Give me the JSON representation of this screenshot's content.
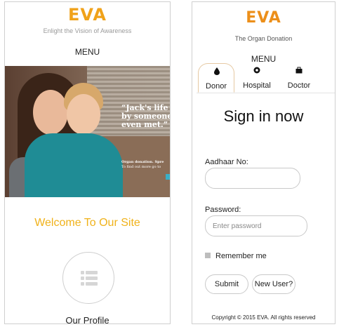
{
  "left_screen": {
    "brand": "EVA",
    "tagline": "Enlight the Vision of Awareness",
    "menu_label": "MENU",
    "hero": {
      "quote_lines": [
        "“Jack's life w",
        "by someone",
        "even met.”"
      ],
      "sub_lines": [
        "Organ donation. Spre",
        "To find out more go to"
      ]
    },
    "welcome_heading": "Welcome To Our Site",
    "profile_label": "Our Profile"
  },
  "right_screen": {
    "brand": "EVA",
    "tagline": "The Organ Donation",
    "menu_label": "MENU",
    "tabs": [
      {
        "label": "Donor",
        "icon": "drop-icon",
        "active": true
      },
      {
        "label": "Hospital",
        "icon": "location-pin-icon",
        "active": false
      },
      {
        "label": "Doctor",
        "icon": "briefcase-icon",
        "active": false
      }
    ],
    "signin_heading": "Sign in now",
    "form": {
      "aadhaar_label": "Aadhaar No:",
      "aadhaar_value": "",
      "aadhaar_placeholder": "",
      "password_label": "Password:",
      "password_placeholder": "Enter password",
      "remember_label": "Remember me",
      "remember_checked": false,
      "submit_label": "Submit",
      "new_user_label": "New User?"
    },
    "copyright": "Copyright © 2015 EVA. All rights reserved"
  },
  "colors": {
    "brand_left": "#f0a21a",
    "brand_right": "#ec8f1a",
    "welcome": "#f0b21a",
    "border": "#c9c9c9"
  }
}
